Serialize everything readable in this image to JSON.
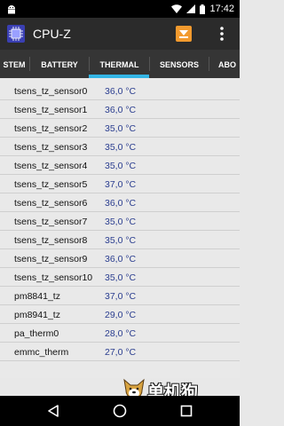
{
  "status_bar": {
    "time": "17:42",
    "icons": [
      "android-icon",
      "wifi-icon",
      "signal-icon",
      "battery-icon"
    ]
  },
  "app_bar": {
    "title": "CPU-Z",
    "icons": [
      "cpu-chip-icon",
      "save-report-icon",
      "overflow-menu-icon"
    ],
    "accent": "#33b5e5",
    "background": "#2b2b2b"
  },
  "tabs": [
    {
      "label": "STEM"
    },
    {
      "label": "BATTERY"
    },
    {
      "label": "THERMAL",
      "selected": true
    },
    {
      "label": "SENSORS"
    },
    {
      "label": "ABO"
    }
  ],
  "thermal": {
    "rows": [
      {
        "label": "tsens_tz_sensor0",
        "value": "36,0 °C"
      },
      {
        "label": "tsens_tz_sensor1",
        "value": "36,0 °C"
      },
      {
        "label": "tsens_tz_sensor2",
        "value": "35,0 °C"
      },
      {
        "label": "tsens_tz_sensor3",
        "value": "35,0 °C"
      },
      {
        "label": "tsens_tz_sensor4",
        "value": "35,0 °C"
      },
      {
        "label": "tsens_tz_sensor5",
        "value": "37,0 °C"
      },
      {
        "label": "tsens_tz_sensor6",
        "value": "36,0 °C"
      },
      {
        "label": "tsens_tz_sensor7",
        "value": "35,0 °C"
      },
      {
        "label": "tsens_tz_sensor8",
        "value": "35,0 °C"
      },
      {
        "label": "tsens_tz_sensor9",
        "value": "36,0 °C"
      },
      {
        "label": "tsens_tz_sensor10",
        "value": "35,0 °C"
      },
      {
        "label": "pm8841_tz",
        "value": "37,0 °C"
      },
      {
        "label": "pm8941_tz",
        "value": "29,0 °C"
      },
      {
        "label": "pa_therm0",
        "value": "28,0 °C"
      },
      {
        "label": "emmc_therm",
        "value": "27,0 °C"
      }
    ],
    "value_color": "#2a3d8f"
  },
  "nav_bar": {
    "icons": [
      "back-icon",
      "home-icon",
      "recents-icon"
    ]
  },
  "watermark": {
    "text": "单机狗"
  }
}
